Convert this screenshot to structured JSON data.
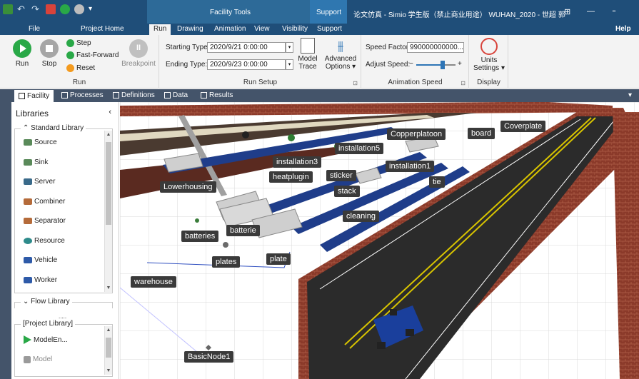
{
  "title_bar": {
    "tools_context": "Facility Tools",
    "support_context": "Support",
    "window_title": "论文仿真 - Simio 学生版（禁止商业用途） WUHAN_2020 - 世超 郭",
    "minimize": "—",
    "restore": "▫",
    "options": "⊞"
  },
  "tabs": {
    "file": "File",
    "project_home": "Project Home",
    "run": "Run",
    "drawing": "Drawing",
    "animation": "Animation",
    "view": "View",
    "visibility": "Visibility",
    "support": "Support",
    "help": "Help"
  },
  "ribbon": {
    "run_group": {
      "label": "Run",
      "run": "Run",
      "stop": "Stop",
      "step": "Step",
      "fast_forward": "Fast-Forward",
      "reset": "Reset",
      "breakpoint": "Breakpoint"
    },
    "run_setup": {
      "label": "Run Setup",
      "starting_type_label": "Starting Type:",
      "starting_type_value": "2020/9/21 0:00:00",
      "ending_type_label": "Ending Type:",
      "ending_type_value": "2020/9/23 0:00:00",
      "model_trace_1": "Model",
      "model_trace_2": "Trace",
      "advanced_1": "Advanced",
      "advanced_2": "Options ▾",
      "expander": "⊡"
    },
    "animation_speed": {
      "label": "Animation Speed",
      "speed_factor_label": "Speed Factor:",
      "speed_factor_value": "990000000000...",
      "adjust_speed_label": "Adjust Speed:",
      "minus": "−",
      "plus": "+",
      "expander": "⊡"
    },
    "display": {
      "label": "Display",
      "units_1": "Units",
      "units_2": "Settings ▾"
    }
  },
  "subtabs": {
    "facility": "Facility",
    "processes": "Processes",
    "definitions": "Definitions",
    "data": "Data",
    "results": "Results",
    "menu_arrow": "▾"
  },
  "libraries": {
    "header": "Libraries",
    "collapse": "‹",
    "standard_title": "Standard Library",
    "standard_items": [
      "Source",
      "Sink",
      "Server",
      "Combiner",
      "Separator",
      "Resource",
      "Vehicle",
      "Worker"
    ],
    "flow_title": "Flow Library",
    "ellipsis": ".....",
    "project_title": "[Project Library]",
    "project_items": [
      "ModelEn...",
      "Model"
    ]
  },
  "facility_labels": {
    "copperplatoon": "Copperplatoon",
    "board": "board",
    "coverplate": "Coverplate",
    "installation5": "installation5",
    "installation3": "installation3",
    "installation1": "installation1",
    "heatplugin": "heatplugin",
    "sticker": "sticker",
    "tie": "tie",
    "stack": "stack",
    "lowerhousing": "Lowerhousing",
    "cleaning": "cleaning",
    "batterie": "batterie",
    "batteries": "batteries",
    "plates": "plates",
    "plate": "plate",
    "warehouse": "warehouse",
    "basicnode1": "BasicNode1"
  },
  "colors": {
    "title_bar": "#1f4e79",
    "ribbon": "#f3f3f3",
    "subtab_bar": "#44546a",
    "label_bg": "#3a3a3a",
    "road": "#2b2b2b",
    "road_line": "#d8c400",
    "brick": "#8b3a2a",
    "vehicle": "#1a3f9c",
    "run_green": "#29a847"
  }
}
